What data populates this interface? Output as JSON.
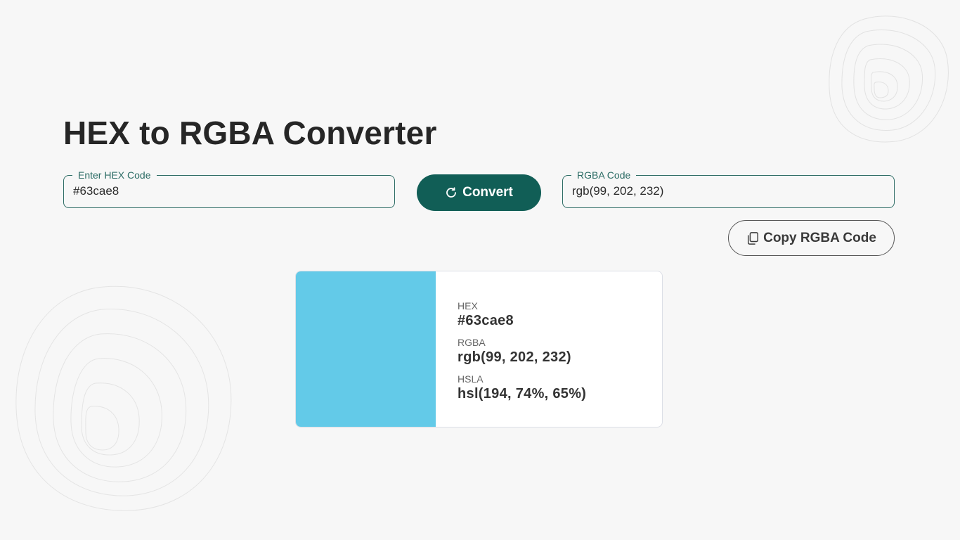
{
  "title": "HEX to RGBA Converter",
  "hex_input": {
    "label": "Enter HEX Code",
    "value": "#63cae8"
  },
  "convert_button": {
    "label": "Convert",
    "icon": "refresh-icon"
  },
  "rgba_output": {
    "label": "RGBA Code",
    "value": "rgb(99, 202, 232)"
  },
  "copy_button": {
    "label": "Copy RGBA Code",
    "icon": "copy-icon"
  },
  "result": {
    "swatch_color": "#63cae8",
    "hex_label": "HEX",
    "hex_value": "#63cae8",
    "rgba_label": "RGBA",
    "rgba_value": "rgb(99, 202, 232)",
    "hsla_label": "HSLA",
    "hsla_value": "hsl(194, 74%, 65%)"
  },
  "colors": {
    "accent": "#115e56",
    "field_border": "#2f6d66",
    "background": "#f7f7f7"
  }
}
